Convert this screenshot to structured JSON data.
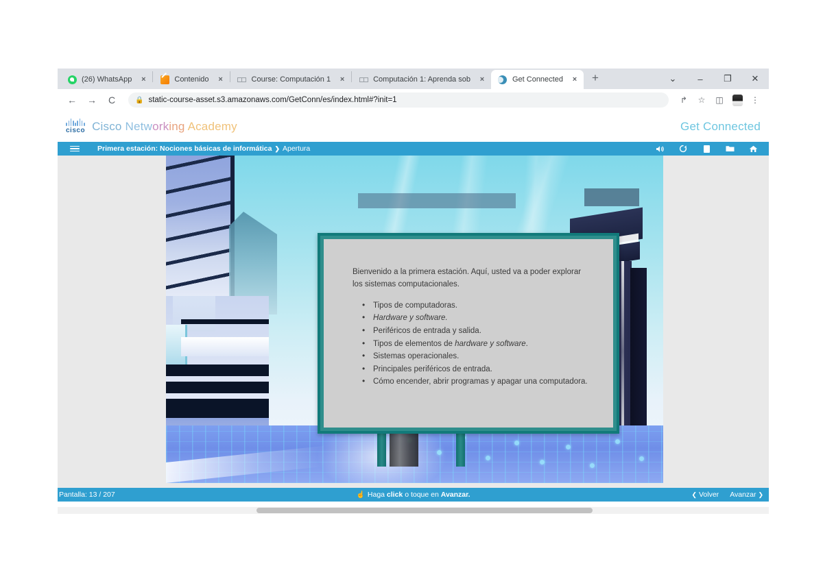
{
  "browser": {
    "tabs": [
      {
        "title": "(26) WhatsApp",
        "favicon": "whatsapp-icon",
        "active": false,
        "close_label": "×"
      },
      {
        "title": "Contenido",
        "favicon": "pencil-icon",
        "active": false,
        "close_label": "×"
      },
      {
        "title": "Course: Computación 1",
        "favicon": "netacad-icon",
        "active": false,
        "close_label": "×"
      },
      {
        "title": "Computación 1: Aprenda sob",
        "favicon": "netacad-icon",
        "active": false,
        "close_label": "×"
      },
      {
        "title": "Get Connected",
        "favicon": "globe-icon",
        "active": true,
        "close_label": "×"
      }
    ],
    "new_tab_label": "+",
    "window_controls": {
      "expand": "⌄",
      "minimize": "–",
      "maximize": "❐",
      "close": "✕"
    },
    "toolbar": {
      "back": "←",
      "forward": "→",
      "reload": "C",
      "lock_icon": "🔒",
      "url": "static-course-asset.s3.amazonaws.com/GetConn/es/index.html#?init=1",
      "share": "↱",
      "bookmark": "☆",
      "sidepanel": "◫",
      "profile": "",
      "menu": "⋮"
    }
  },
  "app": {
    "brand": {
      "cisco_wordmark": "cisco",
      "name_parts": [
        "Cisco ",
        "Netw",
        "ork",
        "ing ",
        "Academy"
      ]
    },
    "course_title": "Get Connected",
    "navbar": {
      "menu_icon": "hamburger-icon",
      "breadcrumb_bold": "Primera estación: Nociones básicas de informática",
      "breadcrumb_sep": "❯",
      "breadcrumb_current": "Apertura",
      "icons": {
        "audio": "🔊",
        "reset": "↻",
        "notes": "notes-icon",
        "resources": "📁",
        "home": "⌂"
      }
    },
    "panel": {
      "intro": "Bienvenido a la primera estación. Aquí, usted va a poder explorar los sistemas computacionales.",
      "bullets": [
        {
          "text": "Tipos de computadoras.",
          "italic": ""
        },
        {
          "text": "",
          "italic": "Hardware y software.",
          "suffix": ""
        },
        {
          "text": "Periféricos de entrada y salida.",
          "italic": ""
        },
        {
          "text": "Tipos de elementos de ",
          "italic": "hardware y software",
          "suffix": "."
        },
        {
          "text": "Sistemas operacionales.",
          "italic": ""
        },
        {
          "text": "Principales periféricos de entrada.",
          "italic": ""
        },
        {
          "text": "Cómo encender, abrir programas y apagar una computadora.",
          "italic": ""
        }
      ]
    },
    "footer": {
      "screen_label": "Pantalla: 13 / 207",
      "hint_icon": "☝",
      "hint_prefix": "Haga ",
      "hint_bold1": "click",
      "hint_mid": " o toque en ",
      "hint_bold2": "Avanzar.",
      "back_label": "Volver",
      "back_chevron": "❮",
      "next_label": "Avanzar",
      "next_chevron": "❯"
    }
  },
  "colors": {
    "nav_blue": "#2f9fd0",
    "panel_teal": "#117a7a",
    "panel_teal_light": "#2f8e8c",
    "panel_bg": "#cfcfcf",
    "get_connected": "#6ec6e0"
  }
}
